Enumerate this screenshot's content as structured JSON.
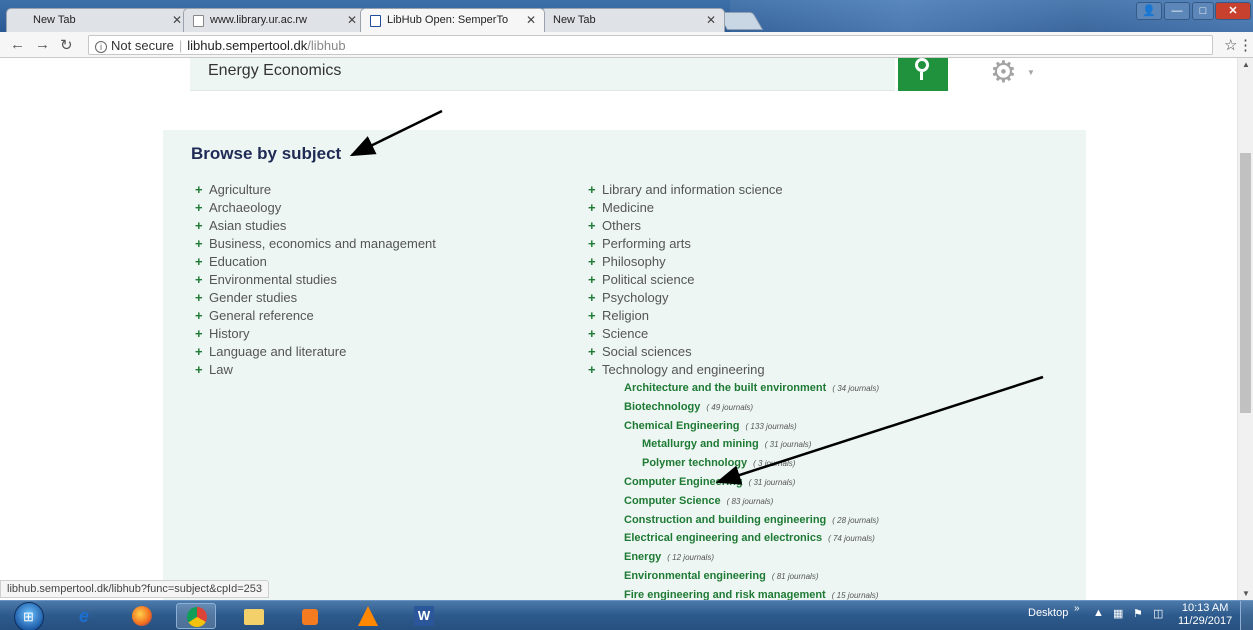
{
  "browser": {
    "tabs": [
      {
        "title": "New Tab",
        "active": false
      },
      {
        "title": "www.library.ur.ac.rw",
        "active": false
      },
      {
        "title": "LibHub Open: SemperTo",
        "active": true
      },
      {
        "title": "New Tab",
        "active": false
      }
    ],
    "address": {
      "security": "Not secure",
      "host": "libhub.sempertool.dk",
      "path": "/libhub"
    },
    "status_url": "libhub.sempertool.dk/libhub?func=subject&cpId=253"
  },
  "search": {
    "value": "Energy Economics"
  },
  "browse": {
    "title": "Browse by subject",
    "left_subjects": [
      "Agriculture",
      "Archaeology",
      "Asian studies",
      "Business, economics and management",
      "Education",
      "Environmental studies",
      "Gender studies",
      "General reference",
      "History",
      "Language and literature",
      "Law"
    ],
    "right_subjects": [
      "Library and information science",
      "Medicine",
      "Others",
      "Performing arts",
      "Philosophy",
      "Political science",
      "Psychology",
      "Religion",
      "Science",
      "Social sciences",
      "Technology and engineering"
    ],
    "expanded_subcategories": [
      {
        "name": "Architecture and the built environment",
        "count": "( 34 journals)",
        "indent": false
      },
      {
        "name": "Biotechnology",
        "count": "( 49 journals)",
        "indent": false
      },
      {
        "name": "Chemical Engineering",
        "count": "( 133 journals)",
        "indent": false
      },
      {
        "name": "Metallurgy and mining",
        "count": "( 31 journals)",
        "indent": true
      },
      {
        "name": "Polymer technology",
        "count": "( 3 journals)",
        "indent": true
      },
      {
        "name": "Computer Engineering",
        "count": "( 31 journals)",
        "indent": false
      },
      {
        "name": "Computer Science",
        "count": "( 83 journals)",
        "indent": false
      },
      {
        "name": "Construction and building engineering",
        "count": "( 28 journals)",
        "indent": false
      },
      {
        "name": "Electrical engineering and electronics",
        "count": "( 74 journals)",
        "indent": false
      },
      {
        "name": "Energy",
        "count": "( 12 journals)",
        "indent": false
      },
      {
        "name": "Environmental engineering",
        "count": "( 81 journals)",
        "indent": false
      },
      {
        "name": "Fire engineering and risk management",
        "count": "( 15 journals)",
        "indent": false
      }
    ]
  },
  "taskbar": {
    "desktop_label": "Desktop",
    "time": "10:13 AM",
    "date": "11/29/2017"
  },
  "colors": {
    "accent_green": "#1e7a34",
    "search_button": "#20913c",
    "panel_bg": "#edf6f3",
    "title_navy": "#1f2a55"
  }
}
